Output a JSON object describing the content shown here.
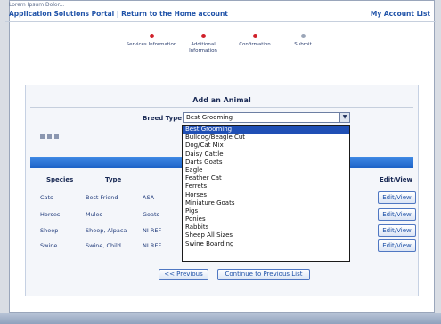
{
  "window": {
    "topline": "Lorem Ipsum Dolor...",
    "title": "Application Solutions Portal | Return to the Home account",
    "account_link": "My Account List"
  },
  "steps": [
    {
      "label": "Services Information",
      "state": "done"
    },
    {
      "label": "Additional Information",
      "state": "done"
    },
    {
      "label": "Confirmation",
      "state": "current"
    },
    {
      "label": "Submit",
      "state": "pending"
    }
  ],
  "form": {
    "title": "Add an Animal",
    "field_label": "Breed Type",
    "selected_value": "Best Grooming",
    "dropdown_options": [
      "Best Grooming",
      "Bulldog/Beagle Cut",
      "Dog/Cat Mix",
      "Daisy Cattle",
      "Darts Goats",
      "Eagle",
      "Feather Cat",
      "Ferrets",
      "Horses",
      "Miniature Goats",
      "Pigs",
      "Ponies",
      "Rabbits",
      "Sheep All Sizes",
      "Swine Boarding"
    ],
    "selected_index": 0
  },
  "table": {
    "headers": [
      "Species",
      "Type",
      "Edit/View"
    ],
    "rows": [
      {
        "species": "Cats",
        "type": "Best Friend",
        "extra": "ASA",
        "action": "Edit/View"
      },
      {
        "species": "Horses",
        "type": "Mules",
        "extra": "Goats",
        "action": "Edit/View"
      },
      {
        "species": "Sheep",
        "type": "Sheep, Alpaca",
        "extra": "NI REF",
        "action": "Edit/View"
      },
      {
        "species": "Swine",
        "type": "Swine, Child",
        "extra": "NI REF",
        "action": "Edit/View"
      }
    ]
  },
  "buttons": {
    "previous": "<< Previous",
    "continue": "Continue to Previous List"
  },
  "colors": {
    "accent_blue": "#1d62c7",
    "selection_blue": "#1f4fb5",
    "step_red": "#d0202a",
    "link_blue": "#1f52a8"
  }
}
